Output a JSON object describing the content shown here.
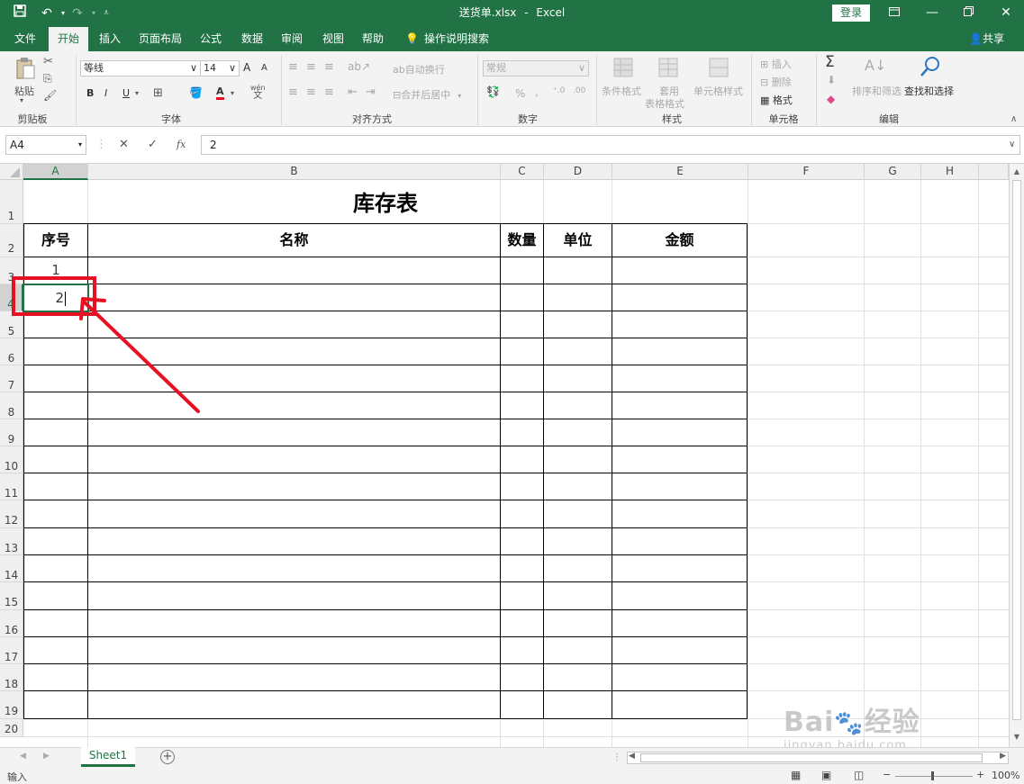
{
  "titlebar": {
    "filename": "送货单.xlsx",
    "separator": "-",
    "app": "Excel",
    "login": "登录",
    "qat_save_icon": "save-icon",
    "qat_undo_icon": "undo-icon",
    "qat_redo_icon": "redo-icon"
  },
  "tabs": [
    "文件",
    "开始",
    "插入",
    "页面布局",
    "公式",
    "数据",
    "审阅",
    "视图",
    "帮助"
  ],
  "active_tab": "开始",
  "tell_me": "操作说明搜索",
  "share": "共享",
  "ribbon": {
    "clipboard": {
      "label": "剪贴板",
      "paste": "粘贴"
    },
    "font": {
      "label": "字体",
      "name": "等线",
      "size": "14",
      "bold": "B",
      "italic": "I",
      "underline": "U",
      "grow": "A",
      "shrink": "A",
      "font_color": "A",
      "wen": "wén",
      "wen_char": "文"
    },
    "alignment": {
      "label": "对齐方式",
      "wrap": "自动换行",
      "merge": "合并后居中"
    },
    "number": {
      "label": "数字",
      "format": "常规",
      "percent": "%",
      "comma": ","
    },
    "styles": {
      "label": "样式",
      "conditional": "条件格式",
      "table": "套用",
      "table2": "表格格式",
      "cell_styles": "单元格样式"
    },
    "cells": {
      "label": "单元格",
      "insert": "插入",
      "delete": "删除",
      "format": "格式"
    },
    "editing": {
      "label": "编辑",
      "sum": "Σ",
      "sort": "排序和筛选",
      "find": "查找和选择"
    }
  },
  "formula_bar": {
    "name_box": "A4",
    "fx": "fx",
    "value": "2"
  },
  "columns": [
    "A",
    "B",
    "C",
    "D",
    "E",
    "F",
    "G",
    "H"
  ],
  "rows": [
    "1",
    "2",
    "3",
    "4",
    "5",
    "6",
    "7",
    "8",
    "9",
    "10",
    "11",
    "12",
    "13",
    "14",
    "15",
    "16",
    "17",
    "18",
    "19",
    "20"
  ],
  "table": {
    "title": "库存表",
    "headers": [
      "序号",
      "名称",
      "数量",
      "单位",
      "金额"
    ],
    "a3": "1",
    "a4": "2"
  },
  "sheets": {
    "active": "Sheet1"
  },
  "status": {
    "mode": "输入",
    "zoom": "100%"
  },
  "accent": "#217346",
  "annotation_color": "#e81123",
  "watermark": "Baidu经验 jingyan.baidu.com"
}
